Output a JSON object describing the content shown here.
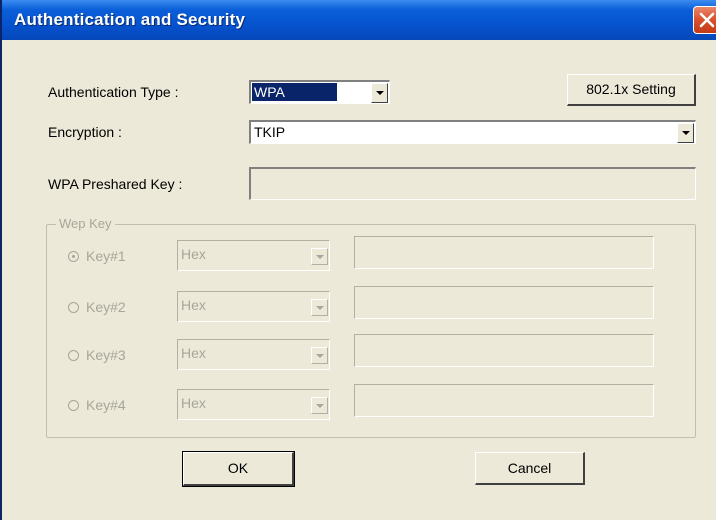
{
  "window": {
    "title": "Authentication and Security"
  },
  "auth_type": {
    "label": "Authentication Type :",
    "value": "WPA"
  },
  "setting_button": {
    "label": "802.1x Setting"
  },
  "encryption": {
    "label": "Encryption :",
    "value": "TKIP"
  },
  "preshared_key": {
    "label": "WPA Preshared Key :",
    "value": ""
  },
  "wep_group": {
    "legend": "Wep Key",
    "keys": [
      {
        "label": "Key#1",
        "format": "Hex",
        "value": "",
        "selected": true
      },
      {
        "label": "Key#2",
        "format": "Hex",
        "value": "",
        "selected": false
      },
      {
        "label": "Key#3",
        "format": "Hex",
        "value": "",
        "selected": false
      },
      {
        "label": "Key#4",
        "format": "Hex",
        "value": "",
        "selected": false
      }
    ]
  },
  "buttons": {
    "ok": "OK",
    "cancel": "Cancel"
  }
}
